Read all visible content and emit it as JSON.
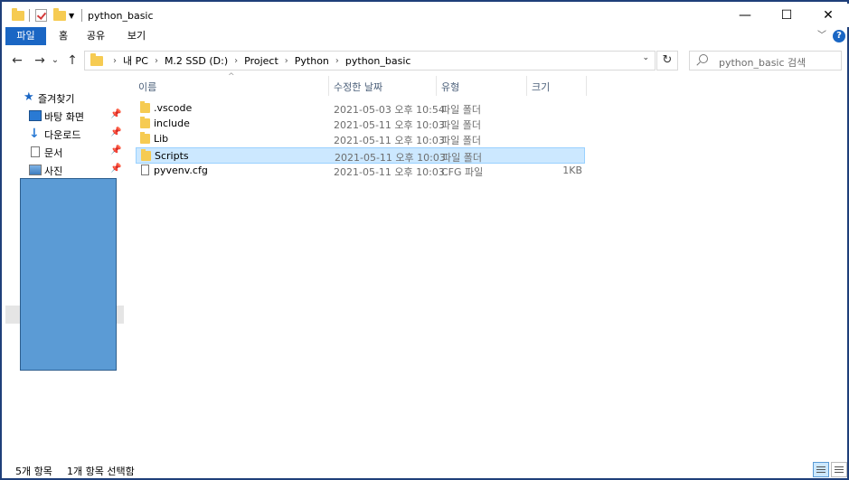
{
  "window": {
    "title": "python_basic",
    "minimize": "—",
    "maximize": "☐",
    "close": "✕"
  },
  "ribbon": {
    "tabs": [
      "파일",
      "홈",
      "공유",
      "보기"
    ],
    "expand_icon": "﹀",
    "help_icon": "?"
  },
  "nav": {
    "back": "←",
    "forward": "→",
    "recent": "⌄",
    "up": "↑",
    "breadcrumbs": [
      "내 PC",
      "M.2 SSD (D:)",
      "Project",
      "Python",
      "python_basic"
    ],
    "refresh": "↻",
    "search_placeholder": "python_basic 검색"
  },
  "sidebar": {
    "quick_access": "즐겨찾기",
    "items": [
      {
        "label": "바탕 화면",
        "icon": "desktop-icon"
      },
      {
        "label": "다운로드",
        "icon": "download-icon"
      },
      {
        "label": "문서",
        "icon": "documents-icon"
      },
      {
        "label": "사진",
        "icon": "pictures-icon"
      }
    ]
  },
  "columns": {
    "name": "이름",
    "date": "수정한 날짜",
    "type": "유형",
    "size": "크기"
  },
  "files": [
    {
      "name": ".vscode",
      "date": "2021-05-03 오후 10:54",
      "type": "파일 폴더",
      "size": "",
      "kind": "folder",
      "selected": false
    },
    {
      "name": "include",
      "date": "2021-05-11 오후 10:03",
      "type": "파일 폴더",
      "size": "",
      "kind": "folder",
      "selected": false
    },
    {
      "name": "Lib",
      "date": "2021-05-11 오후 10:03",
      "type": "파일 폴더",
      "size": "",
      "kind": "folder",
      "selected": false
    },
    {
      "name": "Scripts",
      "date": "2021-05-11 오후 10:03",
      "type": "파일 폴더",
      "size": "",
      "kind": "folder",
      "selected": true
    },
    {
      "name": "pyvenv.cfg",
      "date": "2021-05-11 오후 10:03",
      "type": "CFG 파일",
      "size": "1KB",
      "kind": "file",
      "selected": false
    }
  ],
  "status": {
    "item_count": "5개 항목",
    "selected_count": "1개 항목 선택함"
  },
  "colors": {
    "accent": "#1a66c4",
    "selection": "#cce8ff",
    "folder": "#f6cb52",
    "redaction": "#5b9bd5"
  }
}
